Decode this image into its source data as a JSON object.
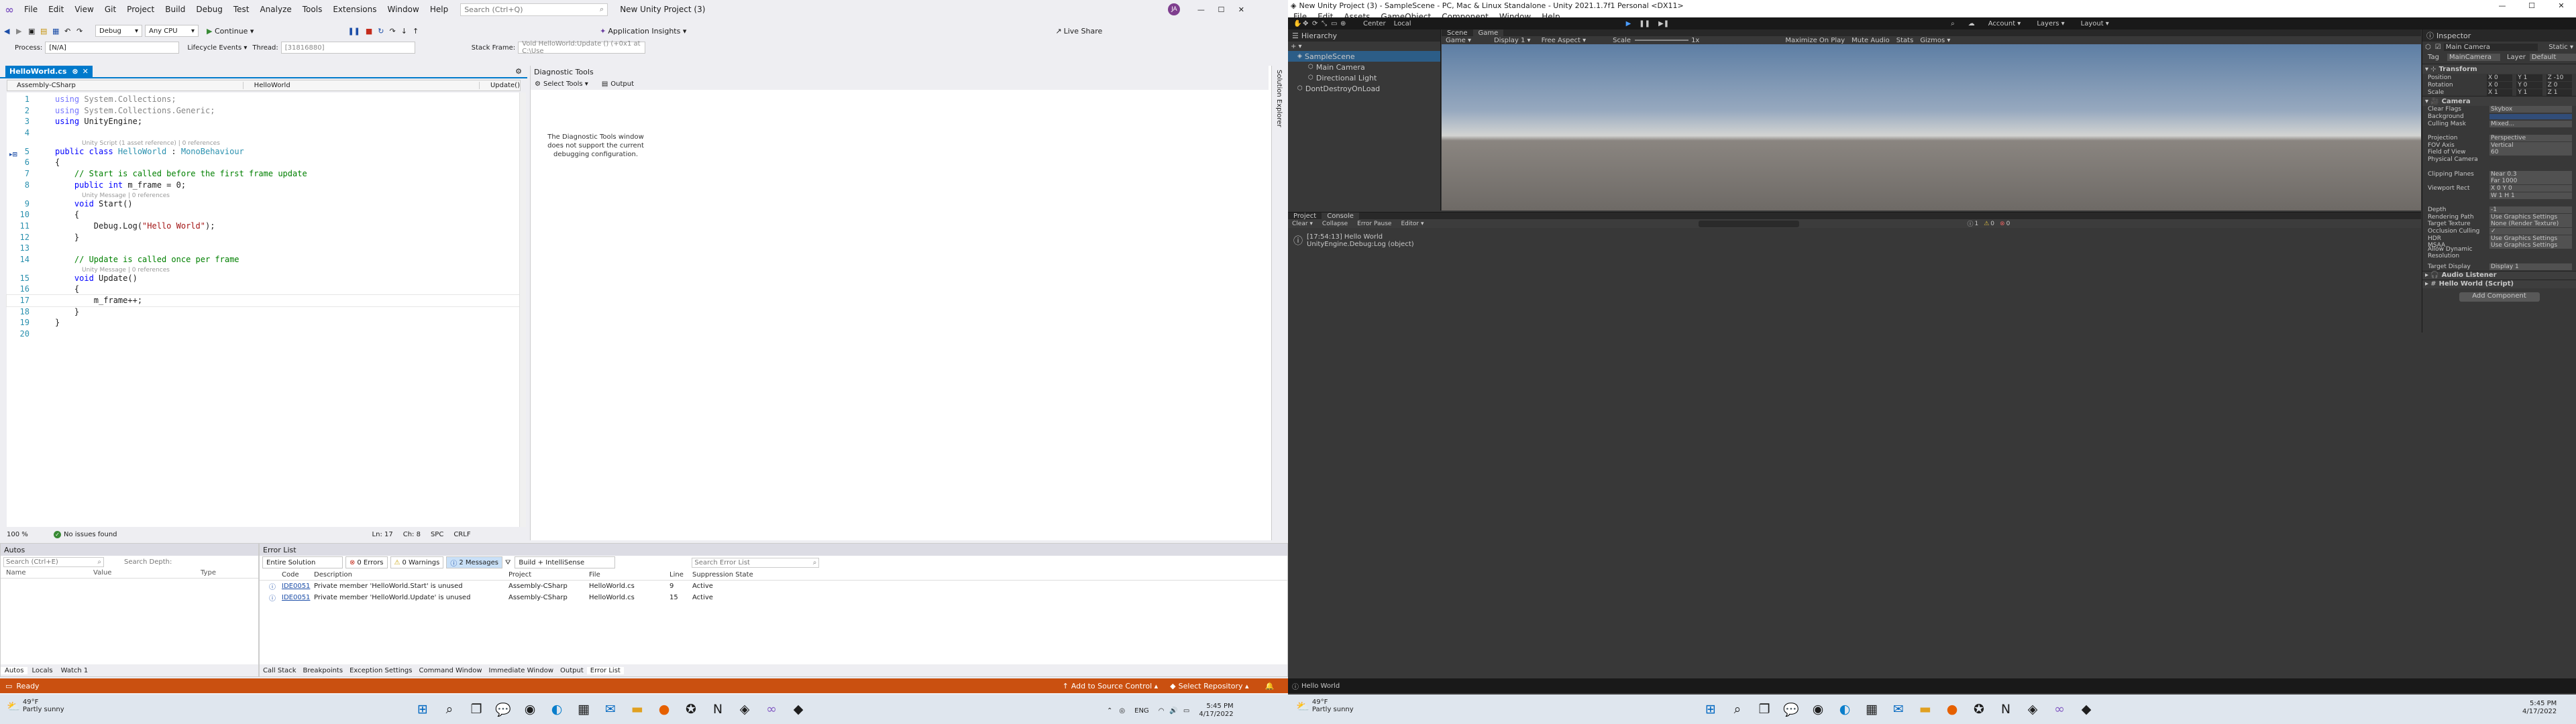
{
  "vs": {
    "menu": [
      "File",
      "Edit",
      "View",
      "Git",
      "Project",
      "Build",
      "Debug",
      "Test",
      "Analyze",
      "Tools",
      "Extensions",
      "Window",
      "Help"
    ],
    "search_placeholder": "Search (Ctrl+Q)",
    "solution_title": "New Unity Project (3)",
    "avatar": "JA",
    "live_share": "Live Share",
    "toolbar": {
      "debug": "Debug",
      "cpu": "Any CPU",
      "continue": "Continue ▾",
      "app_insights": "Application Insights ▾"
    },
    "process_bar": {
      "process_label": "Process:",
      "process_value": "[N/A]",
      "lifecycle": "Lifecycle Events ▾",
      "thread_label": "Thread:",
      "thread_value": "[31816880]",
      "stack_label": "Stack Frame:",
      "stack_value": "Void HelloWorld:Update () (+0x1 at C:\\Use"
    },
    "file_tab": "HelloWorld.cs",
    "nav": {
      "project": "Assembly-CSharp",
      "class": "HelloWorld",
      "member": "Update()"
    },
    "code": [
      {
        "n": "1",
        "t": [
          [
            "kw",
            "using "
          ],
          [
            "",
            "System.Collections;"
          ]
        ],
        "dim": true
      },
      {
        "n": "2",
        "t": [
          [
            "kw",
            "using "
          ],
          [
            "",
            "System.Collections.Generic;"
          ]
        ],
        "dim": true
      },
      {
        "n": "3",
        "t": [
          [
            "kw",
            "using "
          ],
          [
            "",
            "UnityEngine;"
          ]
        ]
      },
      {
        "n": "4",
        "t": []
      },
      {
        "hint": "Unity Script (1 asset reference) | 0 references"
      },
      {
        "n": "5",
        "t": [
          [
            "kw",
            "public class "
          ],
          [
            "ty",
            "HelloWorld"
          ],
          [
            "",
            " : "
          ],
          [
            "ty",
            "MonoBehaviour"
          ]
        ]
      },
      {
        "n": "6",
        "t": [
          [
            "",
            "{"
          ]
        ]
      },
      {
        "n": "7",
        "t": [
          [
            "cm",
            "    // Start is called before the first frame update"
          ]
        ]
      },
      {
        "n": "8",
        "t": [
          [
            "kw",
            "    public int "
          ],
          [
            "",
            "m_frame = 0;"
          ]
        ]
      },
      {
        "hint": "Unity Message | 0 references"
      },
      {
        "n": "9",
        "t": [
          [
            "kw",
            "    void "
          ],
          [
            "",
            "Start()"
          ]
        ]
      },
      {
        "n": "10",
        "t": [
          [
            "",
            "    {"
          ]
        ]
      },
      {
        "n": "11",
        "t": [
          [
            "",
            "        Debug.Log("
          ],
          [
            "st",
            "\"Hello World\""
          ],
          [
            "",
            ");"
          ]
        ]
      },
      {
        "n": "12",
        "t": [
          [
            "",
            "    }"
          ]
        ]
      },
      {
        "n": "13",
        "t": []
      },
      {
        "n": "14",
        "t": [
          [
            "cm",
            "    // Update is called once per frame"
          ]
        ]
      },
      {
        "hint": "Unity Message | 0 references"
      },
      {
        "n": "15",
        "t": [
          [
            "kw",
            "    void "
          ],
          [
            "",
            "Update()"
          ]
        ]
      },
      {
        "n": "16",
        "t": [
          [
            "",
            "    {"
          ]
        ]
      },
      {
        "n": "17",
        "t": [
          [
            "",
            "        m_frame++;"
          ]
        ]
      },
      {
        "n": "18",
        "t": [
          [
            "",
            "    }"
          ]
        ]
      },
      {
        "n": "19",
        "t": [
          [
            "",
            "}"
          ]
        ]
      },
      {
        "n": "20",
        "t": []
      }
    ],
    "status_editor": {
      "zoom": "100 %",
      "issues": "No issues found",
      "ln": "Ln: 17",
      "ch": "Ch: 8",
      "spc": "SPC",
      "crlf": "CRLF"
    },
    "diag": {
      "title": "Diagnostic Tools",
      "select": "Select Tools ▾",
      "output": "Output",
      "message": "The Diagnostic Tools window does not support the current debugging configuration.",
      "side": "Solution Explorer"
    },
    "autos": {
      "title": "Autos",
      "search": "Search (Ctrl+E)",
      "depth": "Search Depth:",
      "cols": [
        "Name",
        "Value",
        "Type"
      ],
      "tabs": [
        "Autos",
        "Locals",
        "Watch 1"
      ]
    },
    "errors": {
      "title": "Error List",
      "scope": "Entire Solution",
      "errors": "0 Errors",
      "warnings": "0 Warnings",
      "messages": "2 Messages",
      "build": "Build + IntelliSense",
      "search": "Search Error List",
      "cols": [
        "",
        "Code",
        "Description",
        "Project",
        "File",
        "Line",
        "Suppression State"
      ],
      "rows": [
        [
          "IDE0051",
          "Private member 'HelloWorld.Start' is unused",
          "Assembly-CSharp",
          "HelloWorld.cs",
          "9",
          "Active"
        ],
        [
          "IDE0051",
          "Private member 'HelloWorld.Update' is unused",
          "Assembly-CSharp",
          "HelloWorld.cs",
          "15",
          "Active"
        ]
      ],
      "tabs": [
        "Call Stack",
        "Breakpoints",
        "Exception Settings",
        "Command Window",
        "Immediate Window",
        "Output",
        "Error List"
      ]
    },
    "status": {
      "ready": "Ready",
      "source": "Add to Source Control ▴",
      "repo": "Select Repository ▴"
    }
  },
  "unity": {
    "title": "New Unity Project (3) - SampleScene - PC, Mac & Linux Standalone - Unity 2021.1.7f1 Personal <DX11>",
    "menu": [
      "File",
      "Edit",
      "Assets",
      "GameObject",
      "Component",
      "Window",
      "Help"
    ],
    "toolbar": {
      "center": "Center",
      "local": "Local",
      "account": "Account ▾",
      "layers": "Layers ▾",
      "layout": "Layout ▾"
    },
    "hierarchy": {
      "title": "Hierarchy",
      "items": [
        "SampleScene",
        "Main Camera",
        "Directional Light",
        "DontDestroyOnLoad"
      ]
    },
    "scene_tabs": [
      "Scene",
      "Game"
    ],
    "game_bar": {
      "game": "Game ▾",
      "display": "Display 1 ▾",
      "aspect": "Free Aspect ▾",
      "scale": "Scale",
      "scale_val": "1x",
      "max": "Maximize On Play",
      "mute": "Mute Audio",
      "stats": "Stats",
      "gizmos": "Gizmos ▾"
    },
    "bottom_tabs": [
      "Project",
      "Console"
    ],
    "console": {
      "clear": "Clear ▾",
      "collapse": "Collapse",
      "pause": "Error Pause",
      "editor": "Editor ▾",
      "counts": [
        "1",
        "0",
        "0"
      ],
      "log1": "[17:54:13] Hello World",
      "log2": "UnityEngine.Debug:Log (object)"
    },
    "inspector": {
      "title": "Inspector",
      "object": "Main Camera",
      "static": "Static ▾",
      "tag_label": "Tag",
      "tag": "MainCamera",
      "layer_label": "Layer",
      "layer": "Default",
      "transform": "Transform",
      "t_rows": [
        [
          "Position",
          "X 0",
          "Y 1",
          "Z -10"
        ],
        [
          "Rotation",
          "X 0",
          "Y 0",
          "Z 0"
        ],
        [
          "Scale",
          "X 1",
          "Y 1",
          "Z 1"
        ]
      ],
      "camera": "Camera",
      "c_rows": [
        [
          "Clear Flags",
          "Skybox"
        ],
        [
          "Background",
          ""
        ],
        [
          "Culling Mask",
          "Mixed..."
        ],
        [
          "",
          ""
        ],
        [
          "Projection",
          "Perspective"
        ],
        [
          "FOV Axis",
          "Vertical"
        ],
        [
          "Field of View",
          "60"
        ],
        [
          "Physical Camera",
          ""
        ],
        [
          "",
          ""
        ],
        [
          "Clipping Planes",
          "Near 0.3"
        ],
        [
          "",
          "Far 1000"
        ],
        [
          "Viewport Rect",
          "X 0    Y 0"
        ],
        [
          "",
          "W 1    H 1"
        ],
        [
          "",
          ""
        ],
        [
          "Depth",
          "-1"
        ],
        [
          "Rendering Path",
          "Use Graphics Settings"
        ],
        [
          "Target Texture",
          "None (Render Texture)"
        ],
        [
          "Occlusion Culling",
          "✓"
        ],
        [
          "HDR",
          "Use Graphics Settings"
        ],
        [
          "MSAA",
          "Use Graphics Settings"
        ],
        [
          "Allow Dynamic Resolution",
          ""
        ],
        [
          "",
          ""
        ],
        [
          "Target Display",
          "Display 1"
        ]
      ],
      "audio": "Audio Listener",
      "script": "Hello World (Script)",
      "add": "Add Component"
    },
    "status": "Hello World"
  },
  "taskbar": {
    "temp": "49°F",
    "weather": "Partly sunny",
    "lang": "ENG",
    "time": "5:45 PM",
    "date": "4/17/2022"
  }
}
